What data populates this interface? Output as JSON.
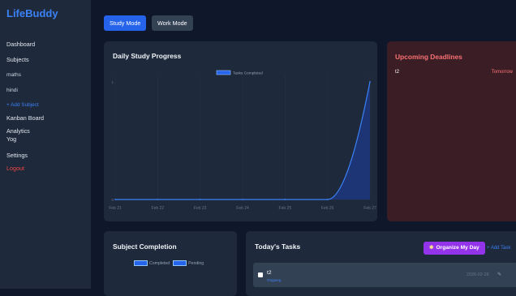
{
  "app": {
    "brand": "LifeBuddy"
  },
  "sidebar": {
    "items": [
      {
        "label": "Dashboard",
        "kind": "nav"
      },
      {
        "label": "Subjects",
        "kind": "nav"
      },
      {
        "label": "maths",
        "kind": "sub"
      },
      {
        "label": "hindi",
        "kind": "sub"
      },
      {
        "label": "+ Add Subject",
        "kind": "add"
      },
      {
        "label": "Kanban Board",
        "kind": "nav"
      },
      {
        "label": "Analytics",
        "kind": "nav"
      },
      {
        "label": "Yog",
        "kind": "nav"
      },
      {
        "label": "Settings",
        "kind": "nav"
      },
      {
        "label": "Logout",
        "kind": "logout"
      }
    ]
  },
  "modes": {
    "study": "Study Mode",
    "work": "Work Mode",
    "active": "Study Mode"
  },
  "progress": {
    "title": "Daily Study Progress"
  },
  "deadlines": {
    "title": "Upcoming Deadlines",
    "items": [
      {
        "task": "t2",
        "when": "Tomorrow"
      }
    ]
  },
  "subject_completion": {
    "title": "Subject Completion",
    "legend": [
      "Completed",
      "Pending"
    ]
  },
  "tasks": {
    "title": "Today's Tasks",
    "organize_label": "Organize My Day",
    "add_label": "+ Add Task",
    "items": [
      {
        "name": "t2",
        "status": "Ongoing",
        "date": "2026-02-28"
      }
    ]
  },
  "colors": {
    "accent": "#2563eb",
    "danger": "#ef4444",
    "purple": "#9333ea",
    "panel": "#1e293b",
    "background": "#0f172a"
  },
  "chart_data": {
    "type": "area",
    "title": "Daily Study Progress",
    "categories": [
      "Feb 21",
      "Feb 22",
      "Feb 23",
      "Feb 24",
      "Feb 25",
      "Feb 26",
      "Feb 27"
    ],
    "series": [
      {
        "name": "Tasks Completed",
        "values": [
          0,
          0,
          0,
          0,
          0,
          0,
          1
        ]
      }
    ],
    "ylim": [
      0,
      1
    ],
    "yticks": [
      "1",
      "0"
    ],
    "legend": "top-center",
    "grid": true
  }
}
